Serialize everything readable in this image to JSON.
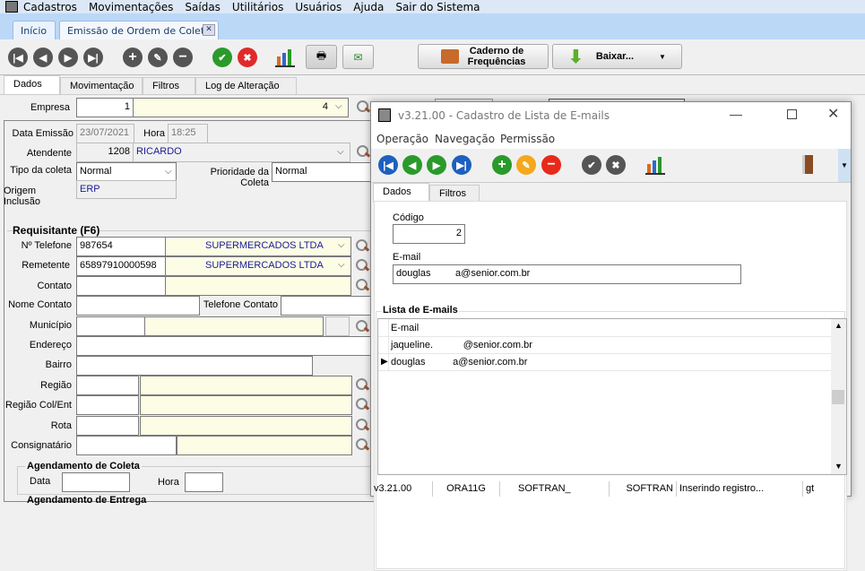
{
  "menu": {
    "items": [
      "Cadastros",
      "Movimentações",
      "Saídas",
      "Utilitários",
      "Usuários",
      "Ajuda",
      "Sair do Sistema"
    ]
  },
  "doc_tabs": [
    "Início",
    "Emissão de Ordem de Coleta"
  ],
  "toolbar": {
    "caderno_label_1": "Caderno de",
    "caderno_label_2": "Frequências",
    "baixar_label": "Baixar..."
  },
  "form_tabs": [
    "Dados",
    "Movimentação",
    "Filtros",
    "Log de Alteração"
  ],
  "form": {
    "empresa_label": "Empresa",
    "empresa_code": "1",
    "empresa_name": "4",
    "data_emissao_label": "Data Emissão",
    "data_emissao": "23/07/2021",
    "hora_label": "Hora",
    "hora": "18:25",
    "atendente_label": "Atendente",
    "atendente_code": "1208",
    "atendente_name": "RICARDO",
    "tipo_label": "Tipo da coleta",
    "tipo": "Normal",
    "prioridade_label": "Prioridade da Coleta",
    "prioridade": "Normal",
    "origem_label": "Origem Inclusão",
    "origem": "ERP",
    "requisitante_label": "Requisitante (F6)",
    "telefone_label": "Nº Telefone",
    "telefone": "987654",
    "telefone_name": "SUPERMERCADOS LTDA",
    "remetente_label": "Remetente",
    "remetente": "65897910000598",
    "remetente_name": "SUPERMERCADOS LTDA",
    "contato_label": "Contato",
    "nome_contato_label": "Nome Contato",
    "telefone_contato_label": "Telefone Contato",
    "municipio_label": "Município",
    "endereco_label": "Endereço",
    "bairro_label": "Bairro",
    "regiao_label": "Região",
    "regiao_col_label": "Região Col/Ent",
    "rota_label": "Rota",
    "consignatario_label": "Consignatário",
    "agend_coleta_label": "Agendamento de Coleta",
    "data_label": "Data",
    "hora2_label": "Hora",
    "agend_entrega_label": "Agendamento de Entrega"
  },
  "dialog": {
    "title": "v3.21.00 - Cadastro de Lista de E-mails",
    "menu": [
      "Operação",
      "Navegação",
      "Permissão"
    ],
    "tabs": [
      "Dados",
      "Filtros"
    ],
    "codigo_label": "Código",
    "codigo": "2",
    "email_label": "E-mail",
    "email": "douglas         a@senior.com.br",
    "lista_label": "Lista de E-mails",
    "grid_header": "E-mail",
    "rows": [
      "jaqueline.           @senior.com.br",
      "douglas          a@senior.com.br"
    ],
    "status": [
      "v3.21.00",
      "ORA11G",
      "SOFTRAN_",
      "SOFTRAN",
      "Inserindo registro...",
      "gt"
    ]
  }
}
